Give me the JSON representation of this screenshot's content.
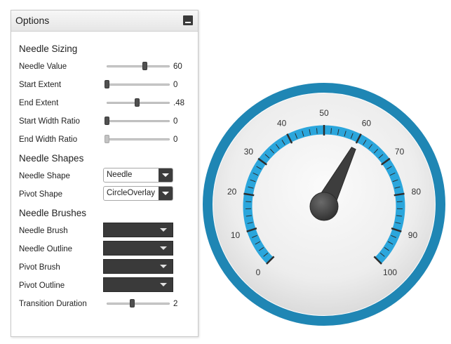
{
  "panel": {
    "title": "Options",
    "collapse_icon": "minimize-icon"
  },
  "sections": {
    "sizing": "Needle Sizing",
    "shapes": "Needle Shapes",
    "brushes": "Needle Brushes"
  },
  "controls": {
    "needle_value": {
      "label": "Needle Value",
      "value": "60",
      "fraction": 0.6
    },
    "start_extent": {
      "label": "Start Extent",
      "value": "0",
      "fraction": 0.0
    },
    "end_extent": {
      "label": "End Extent",
      "value": ".48",
      "fraction": 0.48
    },
    "start_width_ratio": {
      "label": "Start Width Ratio",
      "value": "0",
      "fraction": 0.0
    },
    "end_width_ratio": {
      "label": "End Width Ratio",
      "value": "0",
      "fraction": 0.0,
      "disabled": true
    },
    "needle_shape": {
      "label": "Needle Shape",
      "selected": "Needle"
    },
    "pivot_shape": {
      "label": "Pivot Shape",
      "selected": "CircleOverlay"
    },
    "needle_brush": {
      "label": "Needle Brush",
      "color": "#3a3a3a"
    },
    "needle_outline": {
      "label": "Needle Outline",
      "color": "#3a3a3a"
    },
    "pivot_brush": {
      "label": "Pivot Brush",
      "color": "#3a3a3a"
    },
    "pivot_outline": {
      "label": "Pivot Outline",
      "color": "#3a3a3a"
    },
    "transition_duration": {
      "label": "Transition Duration",
      "value": "2",
      "fraction": 0.4
    }
  },
  "gauge": {
    "min": 0,
    "max": 100,
    "value": 60,
    "labels": [
      "0",
      "10",
      "20",
      "30",
      "40",
      "50",
      "60",
      "70",
      "80",
      "90",
      "100"
    ],
    "colors": {
      "outer_ring": "#1f86b4",
      "range_band": "#2ba6dc",
      "face": "#f2f2f2",
      "needle": "#3d3d3d",
      "ticks": "#2d2d2d"
    }
  }
}
